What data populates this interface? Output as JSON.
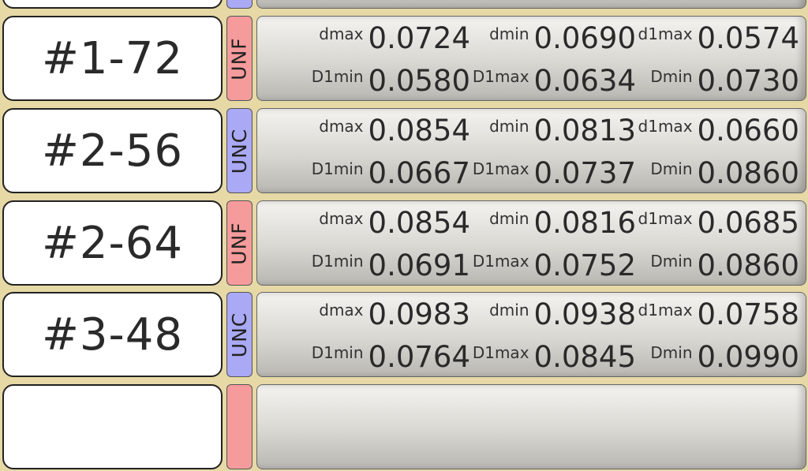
{
  "rows": [
    {
      "name": "#1-72",
      "type": "UNF",
      "dmax": "0.0724",
      "dmin": "0.0690",
      "d1max": "0.0574",
      "D1min": "0.0580",
      "D1max": "0.0634",
      "Dmin": "0.0730"
    },
    {
      "name": "#2-56",
      "type": "UNC",
      "dmax": "0.0854",
      "dmin": "0.0813",
      "d1max": "0.0660",
      "D1min": "0.0667",
      "D1max": "0.0737",
      "Dmin": "0.0860"
    },
    {
      "name": "#2-64",
      "type": "UNF",
      "dmax": "0.0854",
      "dmin": "0.0816",
      "d1max": "0.0685",
      "D1min": "0.0691",
      "D1max": "0.0752",
      "Dmin": "0.0860"
    },
    {
      "name": "#3-48",
      "type": "UNC",
      "dmax": "0.0983",
      "dmin": "0.0938",
      "d1max": "0.0758",
      "D1min": "0.0764",
      "D1max": "0.0845",
      "Dmin": "0.0990"
    }
  ],
  "labels": {
    "dmax": "dmax",
    "dmin": "dmin",
    "d1max": "d1max",
    "D1min": "D1min",
    "D1max": "D1max",
    "Dmin": "Dmin"
  },
  "colors": {
    "background": "#e6d9a6",
    "unf_tag": "#f59b9b",
    "unc_tag": "#a9a9f5"
  }
}
